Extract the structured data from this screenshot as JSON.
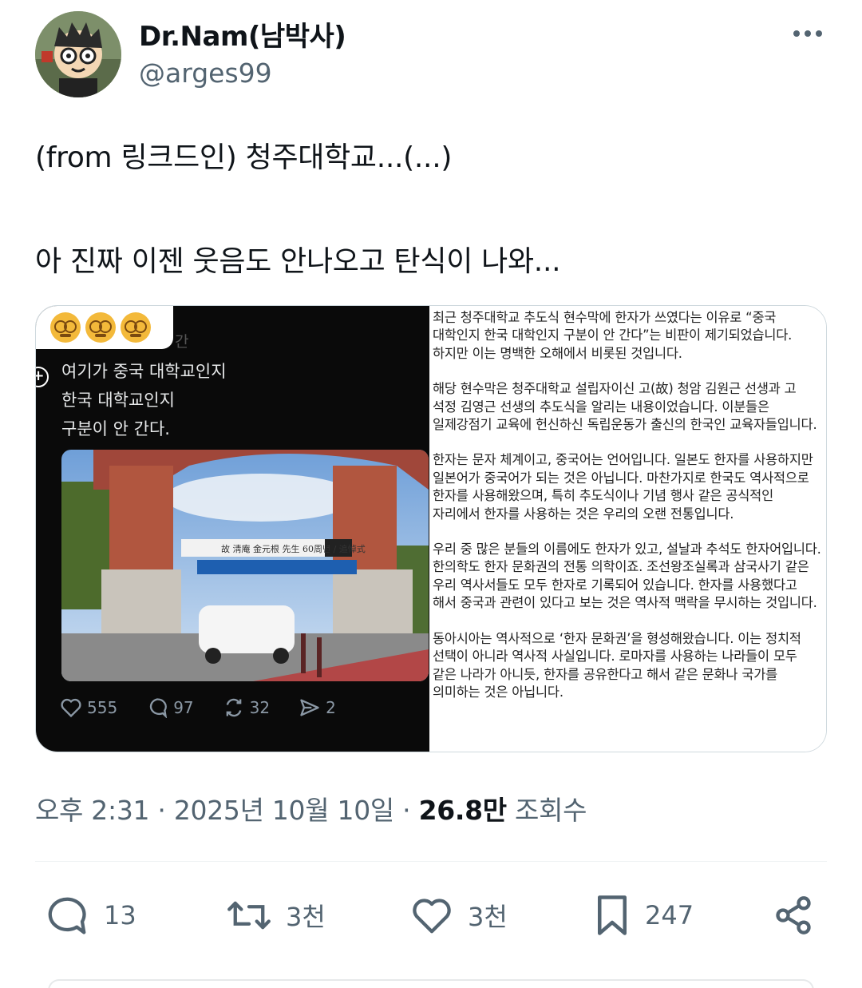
{
  "author": {
    "display_name": "Dr.Nam(남박사)",
    "handle": "@arges99"
  },
  "tweet": {
    "line1": "(from 링크드인) 청주대학교...(...)",
    "line2": "아 진짜 이젠 웃음도 안나오고 탄식이 나와..."
  },
  "media": {
    "ghost_text": "간",
    "quote_lines": [
      "여기가 중국 대학교인지",
      "한국 대학교인지",
      "구분이 안 간다."
    ],
    "banner_text": "故 淸庵 金元根 先生 60周년 / 追悼式",
    "stats": {
      "likes": "555",
      "replies": "97",
      "retweets": "32",
      "shares": "2"
    },
    "paragraphs": [
      "최근 청주대학교 추도식 현수막에 한자가 쓰였다는 이유로 “중국 대학인지 한국 대학인지 구분이 안 간다”는 비판이 제기되었습니다. 하지만 이는 명백한 오해에서 비롯된 것입니다.",
      "해당 현수막은 청주대학교 설립자이신 고(故) 청암 김원근 선생과 고 석정 김영근 선생의 추도식을 알리는 내용이었습니다. 이분들은 일제강점기 교육에 헌신하신 독립운동가 출신의 한국인 교육자들입니다.",
      "한자는 문자 체계이고, 중국어는 언어입니다. 일본도 한자를 사용하지만 일본어가 중국어가 되는 것은 아닙니다. 마찬가지로 한국도 역사적으로 한자를 사용해왔으며, 특히 추도식이나 기념 행사 같은 공식적인 자리에서 한자를 사용하는 것은 우리의 오랜 전통입니다.",
      "우리 중 많은 분들의 이름에도 한자가 있고, 설날과 추석도 한자어입니다. 한의학도 한자 문화권의 전통 의학이죠. 조선왕조실록과 삼국사기 같은 우리 역사서들도 모두 한자로 기록되어 있습니다. 한자를 사용했다고 해서 중국과 관련이 있다고 보는 것은 역사적 맥락을 무시하는 것입니다.",
      "동아시아는 역사적으로 ‘한자 문화권’을 형성해왔습니다. 이는 정치적 선택이 아니라 역사적 사실입니다. 로마자를 사용하는 나라들이 모두 같은 나라가 아니듯, 한자를 공유한다고 해서 같은 문화나 국가를 의미하는 것은 아닙니다."
    ]
  },
  "meta": {
    "time": "오후 2:31",
    "sep1": "·",
    "date": "2025년 10월 10일",
    "sep2": "·",
    "views_count": "26.8만",
    "views_label": "조회수"
  },
  "actions": {
    "replies": "13",
    "retweets": "3천",
    "likes": "3천",
    "bookmarks": "247"
  },
  "colors": {
    "text_primary": "#0f1419",
    "text_secondary": "#536471",
    "border": "#cfd9de"
  }
}
